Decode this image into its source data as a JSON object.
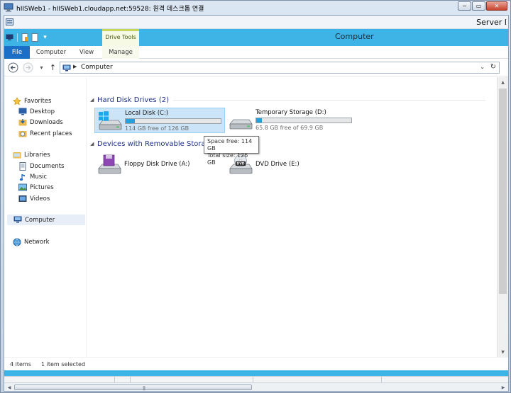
{
  "rdp": {
    "title": "hIISWeb1 - hIISWeb1.cloudapp.net:59528: 원격 데스크톱 연결",
    "minimize": "─",
    "restore": "▭",
    "close": "✕"
  },
  "server_bar": {
    "label": "Server I"
  },
  "ribbon": {
    "context_group": "Drive Tools",
    "window_title": "Computer",
    "tabs": {
      "file": "File",
      "computer": "Computer",
      "view": "View",
      "manage": "Manage"
    },
    "qat_dropdown": "▾"
  },
  "address": {
    "back": "←",
    "forward": "→",
    "recent": "▾",
    "up": "↑",
    "crumb_arrow": "▶",
    "path": "Computer",
    "dropdown": "⌄",
    "refresh": "↻"
  },
  "nav_pane": {
    "favorites": "Favorites",
    "desktop": "Desktop",
    "downloads": "Downloads",
    "recent_places": "Recent places",
    "libraries": "Libraries",
    "documents": "Documents",
    "music": "Music",
    "pictures": "Pictures",
    "videos": "Videos",
    "computer": "Computer",
    "network": "Network"
  },
  "content": {
    "hdd_group": {
      "title": "Hard Disk Drives (2)",
      "arrow": "◢"
    },
    "removable_group": {
      "title": "Devices with Removable Stora",
      "arrow": "◢"
    },
    "drives": [
      {
        "name": "Local Disk (C:)",
        "free_text": "114 GB free of 126 GB",
        "used_fraction": 0.095
      },
      {
        "name": "Temporary Storage (D:)",
        "free_text": "65.8 GB free of 69.9 GB",
        "used_fraction": 0.059
      }
    ],
    "devices": [
      {
        "name": "Floppy Disk Drive (A:)"
      },
      {
        "name": "DVD Drive (E:)",
        "badge": "DVD"
      }
    ],
    "tooltip": {
      "line1": "Space free: 114 GB",
      "line2": "Total size: 126 GB"
    }
  },
  "status": {
    "items": "4 items",
    "selected": "1 item selected"
  },
  "scroll": {
    "up": "▲",
    "down": "▼",
    "left": "◀",
    "right": "▶",
    "grip": "|||"
  },
  "colors": {
    "ribbon_blue": "#3db3e6",
    "file_tab": "#1c6fc7",
    "selection": "#cce4f7",
    "accent_fill": "#26a0da"
  }
}
